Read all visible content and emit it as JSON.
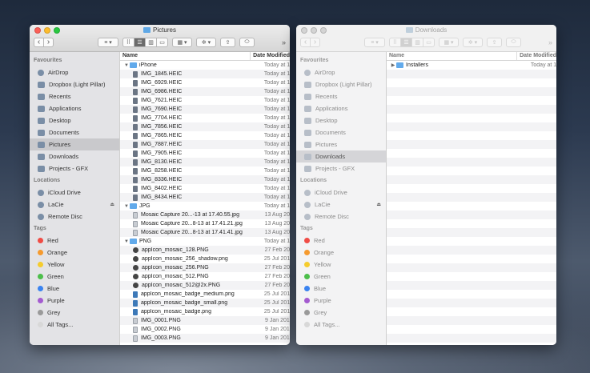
{
  "left_window": {
    "title": "Pictures",
    "columns": {
      "name": "Name",
      "date": "Date Modified"
    },
    "sidebar": {
      "favourites_heading": "Favourites",
      "favourites": [
        {
          "label": "AirDrop",
          "icon": "airdrop-icon"
        },
        {
          "label": "Dropbox (Light Pillar)",
          "icon": "dropbox-icon"
        },
        {
          "label": "Recents",
          "icon": "clock-icon"
        },
        {
          "label": "Applications",
          "icon": "applications-icon"
        },
        {
          "label": "Desktop",
          "icon": "desktop-icon"
        },
        {
          "label": "Documents",
          "icon": "documents-icon"
        },
        {
          "label": "Pictures",
          "icon": "camera-icon",
          "selected": true
        },
        {
          "label": "Downloads",
          "icon": "downloads-icon"
        },
        {
          "label": "Projects - GFX",
          "icon": "folder-icon"
        }
      ],
      "locations_heading": "Locations",
      "locations": [
        {
          "label": "iCloud Drive",
          "icon": "cloud-icon"
        },
        {
          "label": "LaCie",
          "icon": "drive-icon",
          "eject": "⏏"
        },
        {
          "label": "Remote Disc",
          "icon": "disc-icon"
        }
      ],
      "tags_heading": "Tags",
      "tags": [
        {
          "label": "Red",
          "color": "#f04c45"
        },
        {
          "label": "Orange",
          "color": "#f59a2e"
        },
        {
          "label": "Yellow",
          "color": "#f5cc2d"
        },
        {
          "label": "Green",
          "color": "#4cbe4a"
        },
        {
          "label": "Blue",
          "color": "#3a83f0"
        },
        {
          "label": "Purple",
          "color": "#a45bd0"
        },
        {
          "label": "Grey",
          "color": "#9a9a9a"
        },
        {
          "label": "All Tags...",
          "color": "#d8d8d8"
        }
      ]
    },
    "rows": [
      {
        "type": "folder",
        "name": "iPhone",
        "date": "Today at 1"
      },
      {
        "type": "file",
        "name": "IMG_1845.HEIC",
        "date": "Today at 1"
      },
      {
        "type": "file",
        "name": "IMG_6929.HEIC",
        "date": "Today at 1"
      },
      {
        "type": "file",
        "name": "IMG_6986.HEIC",
        "date": "Today at 1"
      },
      {
        "type": "file",
        "name": "IMG_7621.HEIC",
        "date": "Today at 1"
      },
      {
        "type": "file",
        "name": "IMG_7690.HEIC",
        "date": "Today at 1"
      },
      {
        "type": "file",
        "name": "IMG_7704.HEIC",
        "date": "Today at 1"
      },
      {
        "type": "file",
        "name": "IMG_7856.HEIC",
        "date": "Today at 1"
      },
      {
        "type": "file",
        "name": "IMG_7865.HEIC",
        "date": "Today at 1"
      },
      {
        "type": "file",
        "name": "IMG_7887.HEIC",
        "date": "Today at 1"
      },
      {
        "type": "file",
        "name": "IMG_7905.HEIC",
        "date": "Today at 1"
      },
      {
        "type": "file",
        "name": "IMG_8130.HEIC",
        "date": "Today at 1"
      },
      {
        "type": "file",
        "name": "IMG_8258.HEIC",
        "date": "Today at 1"
      },
      {
        "type": "file",
        "name": "IMG_8336.HEIC",
        "date": "Today at 1"
      },
      {
        "type": "file",
        "name": "IMG_8402.HEIC",
        "date": "Today at 1"
      },
      {
        "type": "file",
        "name": "IMG_8434.HEIC",
        "date": "Today at 1"
      },
      {
        "type": "folder",
        "name": "JPG",
        "date": "Today at 1"
      },
      {
        "type": "file-light",
        "name": "Mosaic Capture 20...-13 at 17.40.55.jpg",
        "date": "13 Aug 20"
      },
      {
        "type": "file-light",
        "name": "Mosaic Capture 20...8-13 at 17.41.21.jpg",
        "date": "13 Aug 20"
      },
      {
        "type": "file-light",
        "name": "Mosaic Capture 20...8-13 at 17.41.41.jpg",
        "date": "13 Aug 20"
      },
      {
        "type": "folder",
        "name": "PNG",
        "date": "Today at 1"
      },
      {
        "type": "file-cam",
        "name": "appIcon_mosaic_128.PNG",
        "date": "27 Feb 20"
      },
      {
        "type": "file-cam",
        "name": "appIcon_mosaic_256_shadow.png",
        "date": "25 Jul 201"
      },
      {
        "type": "file-cam",
        "name": "appIcon_mosaic_256.PNG",
        "date": "27 Feb 20"
      },
      {
        "type": "file-cam",
        "name": "appIcon_mosaic_512.PNG",
        "date": "27 Feb 20"
      },
      {
        "type": "file-cam",
        "name": "appIcon_mosaic_512@2x.PNG",
        "date": "27 Feb 20"
      },
      {
        "type": "file-blue",
        "name": "appIcon_mosaic_badge_medium.png",
        "date": "25 Jul 201"
      },
      {
        "type": "file-blue",
        "name": "appIcon_mosaic_badge_small.png",
        "date": "25 Jul 201"
      },
      {
        "type": "file-blue",
        "name": "appIcon_mosaic_badge.png",
        "date": "25 Jul 201"
      },
      {
        "type": "file-light",
        "name": "IMG_0001.PNG",
        "date": "9 Jan 201"
      },
      {
        "type": "file-light",
        "name": "IMG_0002.PNG",
        "date": "9 Jan 201"
      },
      {
        "type": "file-light",
        "name": "IMG_0003.PNG",
        "date": "9 Jan 201"
      }
    ]
  },
  "right_window": {
    "title": "Downloads",
    "columns": {
      "name": "Name",
      "date": "Date Modified"
    },
    "rows": [
      {
        "type": "folder",
        "name": "Installers",
        "date": "Today at 1"
      }
    ]
  },
  "toolbar_icons": [
    "back-icon",
    "forward-icon",
    "arrange-icon",
    "icon-view",
    "list-view",
    "column-view",
    "gallery-view",
    "group-icon",
    "gear-icon",
    "share-icon",
    "tag-icon",
    "more-icon"
  ]
}
